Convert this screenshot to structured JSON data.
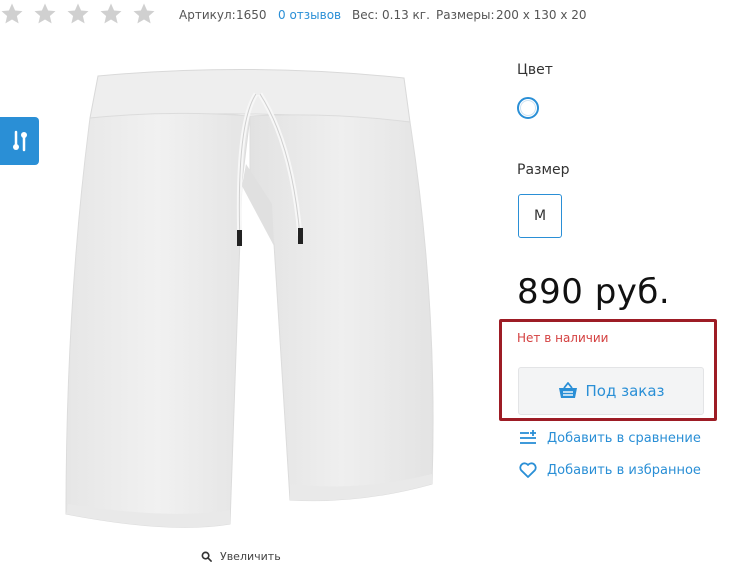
{
  "rating": {
    "filled_stars": 0,
    "max_stars": 5,
    "star_color": "#cfcfcf"
  },
  "meta": {
    "article_label": "Артикул:",
    "article_value": "1650",
    "reviews_link": "0 отзывов",
    "weight_label": "Вес:",
    "weight_value": "0.13 кг.",
    "dimensions_label": "Размеры:",
    "dimensions_value": "200 х 130 х 20"
  },
  "product_image": {
    "alt": "white shorts"
  },
  "zoom_label": "Увеличить",
  "options": {
    "color_label": "Цвет",
    "selected_color": "#ffffff",
    "size_label": "Размер",
    "selected_size": "M"
  },
  "price": "890 руб.",
  "availability": "Нет в наличии",
  "order_button": "Под заказ",
  "actions": {
    "compare": "Добавить в сравнение",
    "favorite": "Добавить в избранное"
  },
  "colors": {
    "accent": "#2a8fd6",
    "out_of_stock": "#d44040",
    "highlight": "#9d1c25"
  }
}
